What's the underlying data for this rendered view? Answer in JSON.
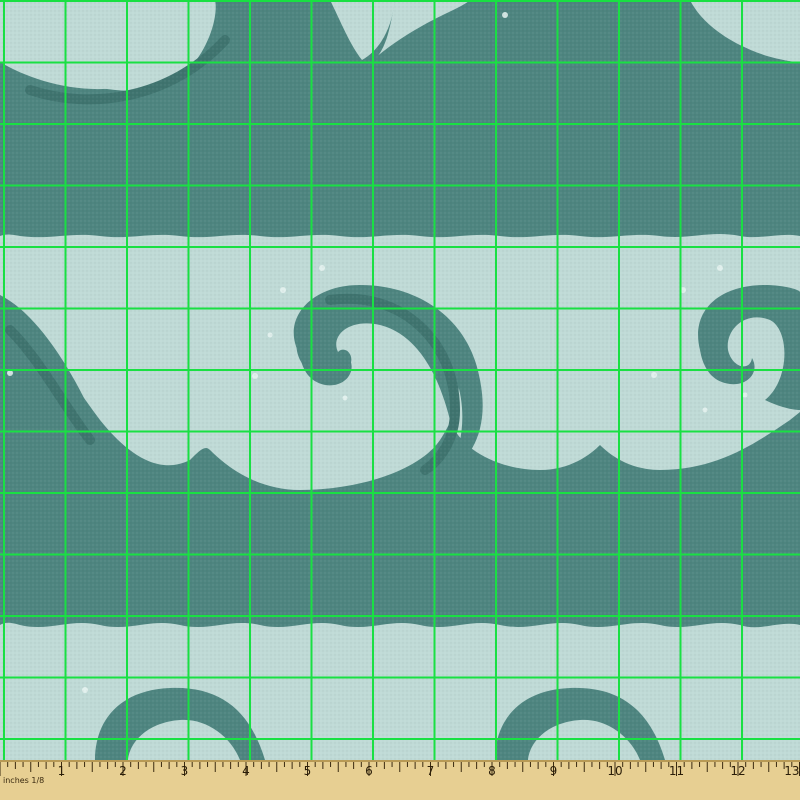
{
  "ruler": {
    "unit_label": "inches 1/8",
    "marks": [
      "1",
      "2",
      "3",
      "4",
      "5",
      "6",
      "7",
      "8",
      "9",
      "10",
      "11",
      "12",
      "13"
    ]
  },
  "colors": {
    "water_light": "#bfdad6",
    "water_dark": "#4e8580",
    "wave_stripe": "#3f746f",
    "grid": "#19e043",
    "ruler_wood": "#e7cf92",
    "ruler_ink": "#3a2a10",
    "bubble": "#e8f4f2"
  },
  "pattern": {
    "motif": "curling ocean waves",
    "grid_cells": 13
  }
}
